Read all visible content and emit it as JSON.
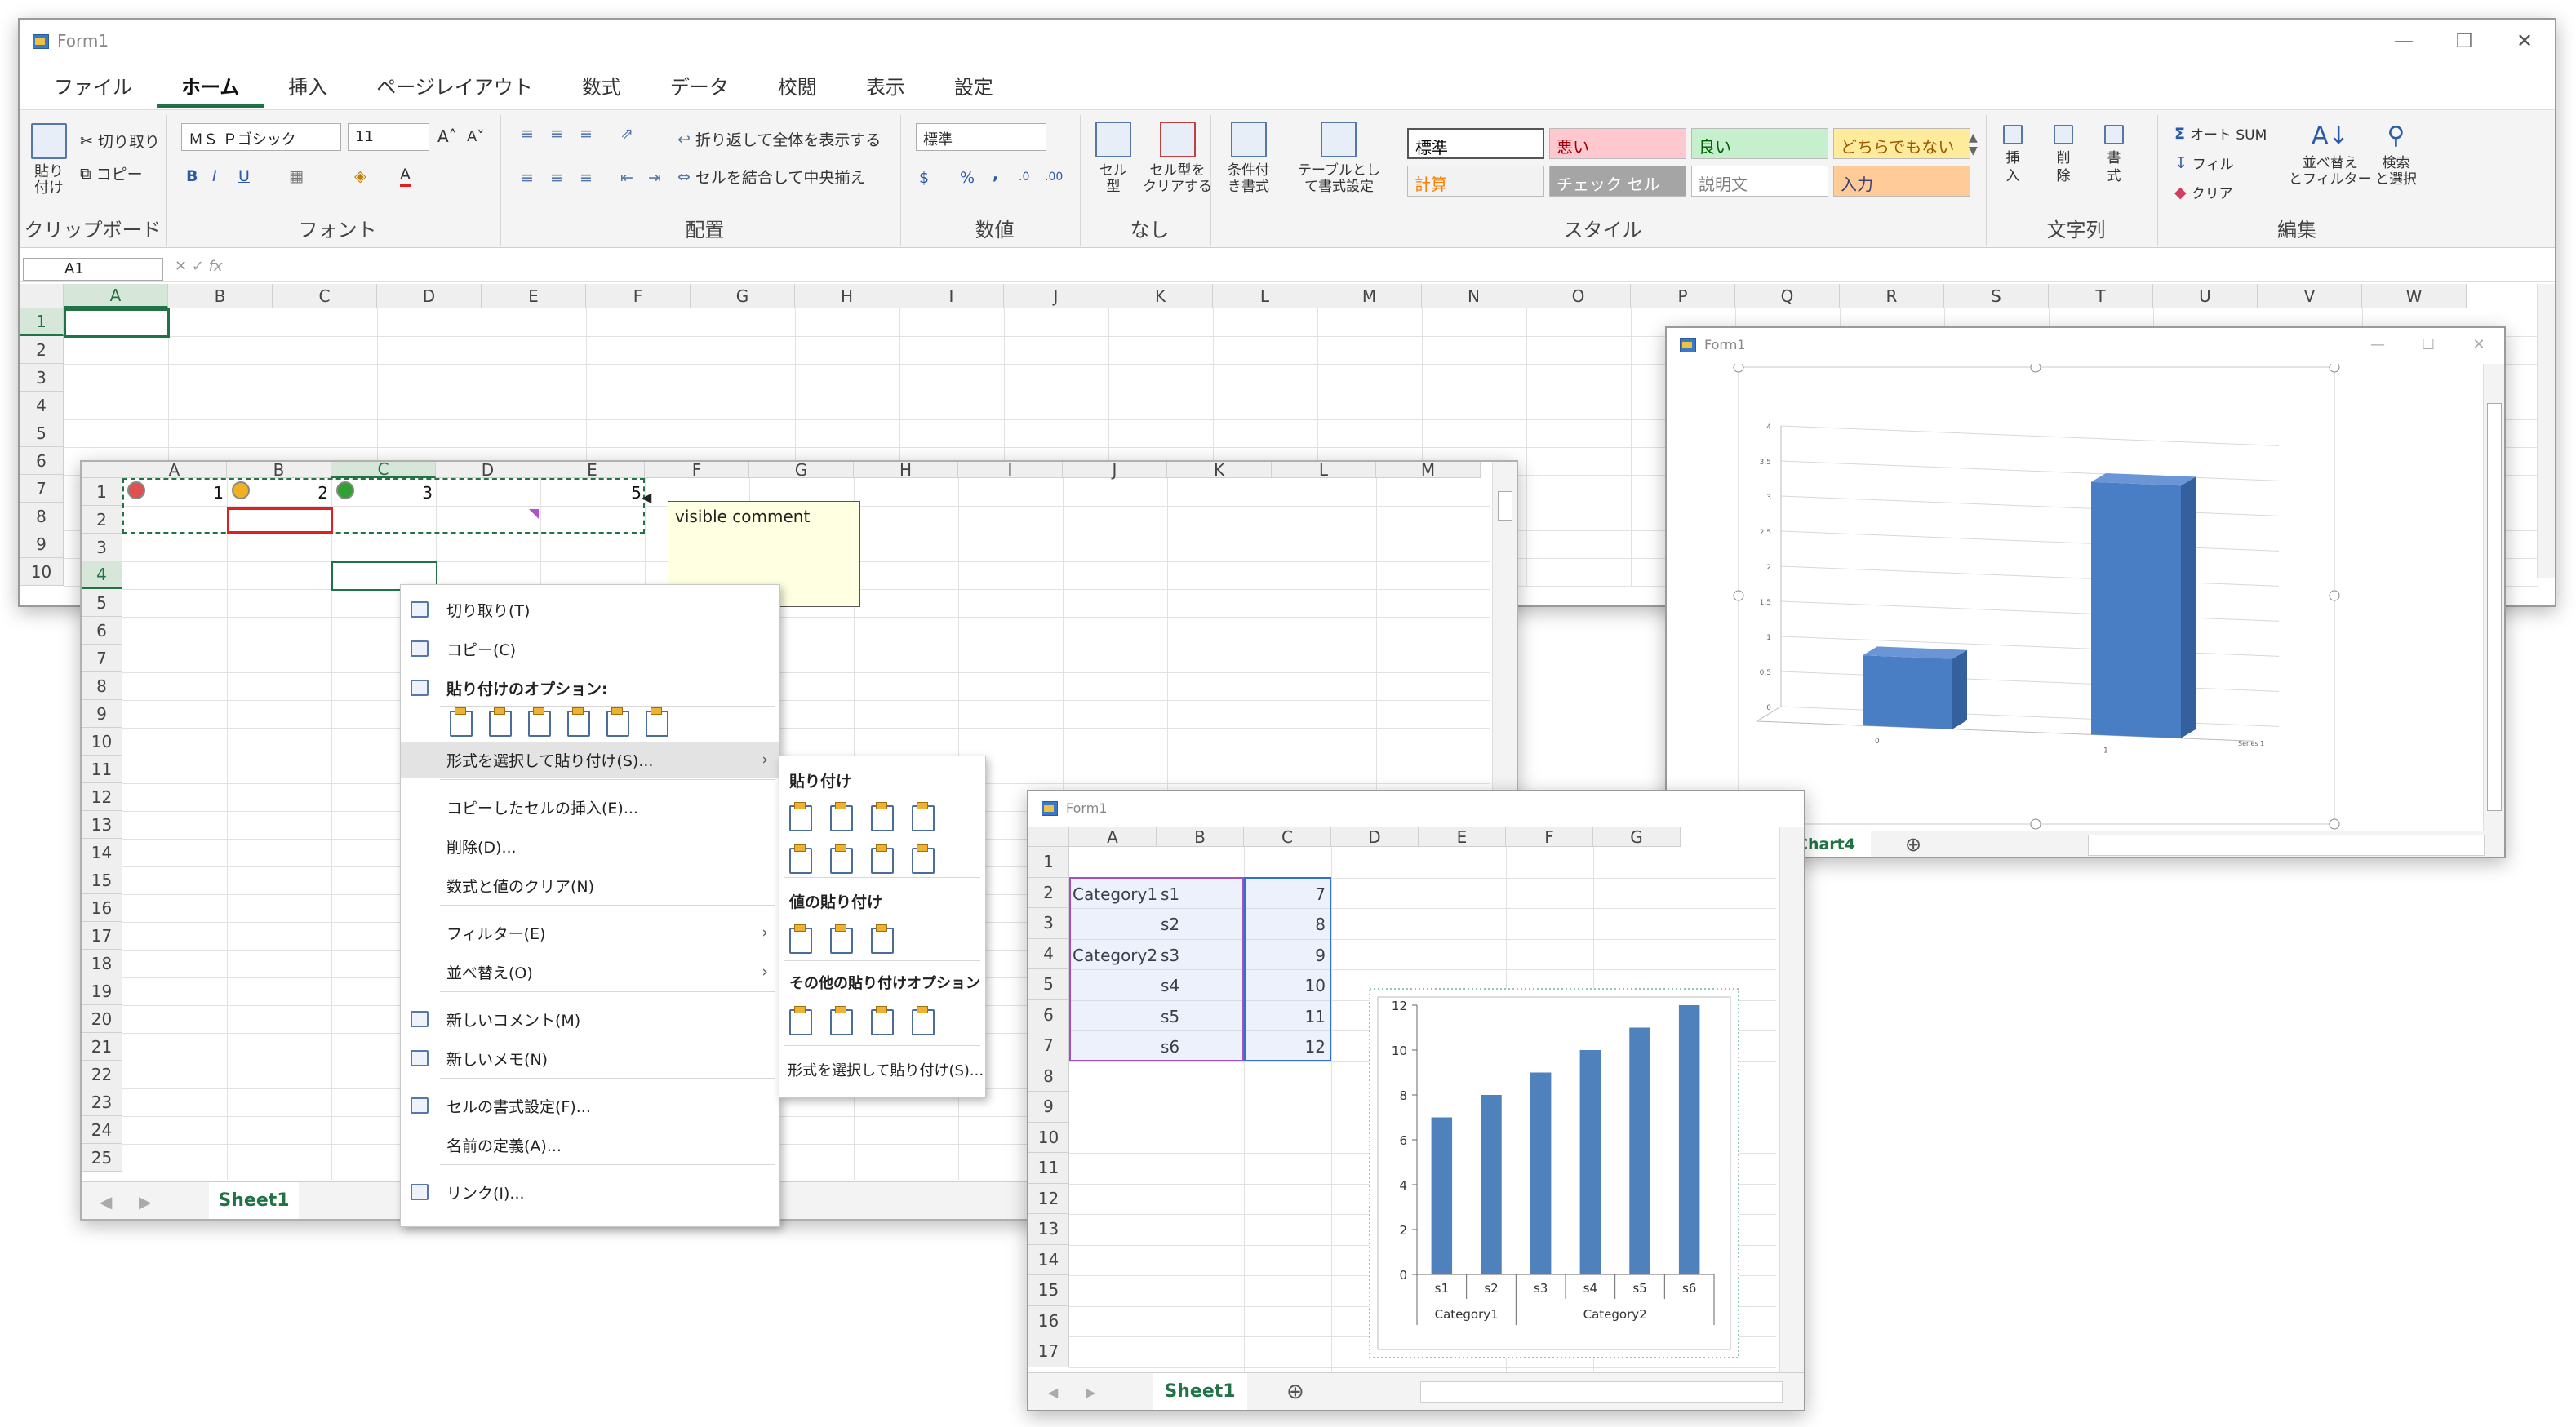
{
  "main_window": {
    "title": "Form1",
    "tabs": [
      "ファイル",
      "ホーム",
      "挿入",
      "ページレイアウト",
      "数式",
      "データ",
      "校閲",
      "表示",
      "設定"
    ],
    "active_tab": "ホーム",
    "clipboard": {
      "paste": "貼り\n付け",
      "cut": "切り取り",
      "copy": "コピー",
      "label": "クリップボード"
    },
    "font": {
      "name": "ＭＳ Ｐゴシック",
      "size": "11",
      "bold": "B",
      "italic": "I",
      "underline": "U",
      "label": "フォント"
    },
    "alignment": {
      "wrap": "折り返して全体を表示する",
      "merge": "セルを結合して中央揃え",
      "label": "配置"
    },
    "number": {
      "format": "標準",
      "currency": "$",
      "percent": "%",
      "comma": ",",
      "label": "数値"
    },
    "cells_group": {
      "cell_type": "セル\n型",
      "clear_cell_type": "セル型を\nクリアする",
      "label": "なし"
    },
    "styles": {
      "cond_format": "条件付\nき書式",
      "table_format": "テーブルとし\nて書式設定",
      "items": [
        {
          "text": "標準",
          "bg": "#ffffff",
          "fg": "#000000"
        },
        {
          "text": "悪い",
          "bg": "#ffc7ce",
          "fg": "#9c0006"
        },
        {
          "text": "良い",
          "bg": "#c6efce",
          "fg": "#006100"
        },
        {
          "text": "どちらでもない",
          "bg": "#ffeb9c",
          "fg": "#9c5700"
        },
        {
          "text": "計算",
          "bg": "#f2f2f2",
          "fg": "#fa7d00"
        },
        {
          "text": "チェック セル",
          "bg": "#a5a5a5",
          "fg": "#ffffff"
        },
        {
          "text": "説明文",
          "bg": "#ffffff",
          "fg": "#7f7f7f"
        },
        {
          "text": "入力",
          "bg": "#ffcc99",
          "fg": "#3f3f76"
        }
      ],
      "label": "スタイル"
    },
    "columns_group": {
      "insert": "挿\n入",
      "delete": "削\n除",
      "format": "書\n式",
      "label": "文字列"
    },
    "editing": {
      "autosum": "オート SUM",
      "fill": "フィル",
      "clear": "クリア",
      "sort": "並べ替え\nとフィルター",
      "find": "検索\nと選択",
      "label": "編集"
    },
    "name_box": "A1",
    "fx": "fx",
    "columns": [
      "A",
      "B",
      "C",
      "D",
      "E",
      "F",
      "G",
      "H",
      "I",
      "J",
      "K",
      "L",
      "M",
      "N",
      "O",
      "P",
      "Q",
      "R",
      "S",
      "T",
      "U",
      "V",
      "W"
    ],
    "rows": [
      "1",
      "2",
      "3",
      "4",
      "5",
      "6",
      "7",
      "8",
      "9",
      "10"
    ]
  },
  "sheet_window": {
    "columns": [
      "A",
      "B",
      "C",
      "D",
      "E",
      "F",
      "G",
      "H",
      "I",
      "J",
      "K",
      "L",
      "M"
    ],
    "rows": [
      "1",
      "2",
      "3",
      "4",
      "5",
      "6",
      "7",
      "8",
      "9",
      "10",
      "11",
      "12",
      "13",
      "14",
      "15",
      "16",
      "17",
      "18",
      "19",
      "20",
      "21",
      "22",
      "23",
      "24",
      "25"
    ],
    "row1_values": [
      "1",
      "2",
      "3",
      "5"
    ],
    "comment": "visible comment",
    "sheet_tab": "Sheet1"
  },
  "context_menu": {
    "items": [
      {
        "label": "切り取り(T)",
        "icon": "scissors-icon"
      },
      {
        "label": "コピー(C)",
        "icon": "copy-icon"
      },
      {
        "label": "貼り付けのオプション:",
        "icon": "paste-icon"
      },
      {
        "label": "形式を選択して貼り付け(S)...",
        "icon": ""
      },
      {
        "label": "コピーしたセルの挿入(E)...",
        "icon": ""
      },
      {
        "label": "削除(D)...",
        "icon": ""
      },
      {
        "label": "数式と値のクリア(N)",
        "icon": ""
      },
      {
        "label": "フィルター(E)",
        "icon": ""
      },
      {
        "label": "並べ替え(O)",
        "icon": ""
      },
      {
        "label": "新しいコメント(M)",
        "icon": "comment-icon"
      },
      {
        "label": "新しいメモ(N)",
        "icon": "note-icon"
      },
      {
        "label": "セルの書式設定(F)...",
        "icon": "format-cells-icon"
      },
      {
        "label": "名前の定義(A)...",
        "icon": ""
      },
      {
        "label": "リンク(I)...",
        "icon": "link-icon"
      }
    ]
  },
  "paste_submenu": {
    "paste_header": "貼り付け",
    "values_header": "値の貼り付け",
    "other_header": "その他の貼り付けオプション",
    "special": "形式を選択して貼り付け(S)..."
  },
  "chart_window_3d": {
    "title": "Form1",
    "sheet_tab": "Chart4",
    "chart_data": {
      "type": "bar",
      "categories": [
        "0",
        "1"
      ],
      "values": [
        1.0,
        3.6
      ],
      "yticks": [
        "0",
        "0.5",
        "1",
        "1.5",
        "2",
        "2.5",
        "3",
        "3.5",
        "4"
      ],
      "series_label": "Series 1",
      "ylim": [
        0,
        4
      ],
      "grid": true,
      "legend": "none"
    }
  },
  "data_window": {
    "title": "Form1",
    "columns": [
      "A",
      "B",
      "C",
      "D",
      "E",
      "F",
      "G"
    ],
    "rows": [
      "1",
      "2",
      "3",
      "4",
      "5",
      "6",
      "7",
      "8",
      "9",
      "10",
      "11",
      "12",
      "13",
      "14",
      "15",
      "16",
      "17"
    ],
    "table": [
      {
        "row": "2",
        "a": "Category1",
        "b": "s1",
        "c": "7"
      },
      {
        "row": "3",
        "a": "",
        "b": "s2",
        "c": "8"
      },
      {
        "row": "4",
        "a": "Category2",
        "b": "s3",
        "c": "9"
      },
      {
        "row": "5",
        "a": "",
        "b": "s4",
        "c": "10"
      },
      {
        "row": "6",
        "a": "",
        "b": "s5",
        "c": "11"
      },
      {
        "row": "7",
        "a": "",
        "b": "s6",
        "c": "12"
      }
    ],
    "sheet_tab": "Sheet1",
    "chart_data": {
      "type": "bar",
      "categories": [
        "s1",
        "s2",
        "s3",
        "s4",
        "s5",
        "s6"
      ],
      "groups": [
        "Category1",
        "Category2"
      ],
      "values": [
        7,
        8,
        9,
        10,
        11,
        12
      ],
      "yticks": [
        "0",
        "2",
        "4",
        "6",
        "8",
        "10",
        "12"
      ],
      "ylim": [
        0,
        12
      ],
      "bar_color": "#4f81bd",
      "grid": false,
      "legend": "none"
    }
  },
  "colors": {
    "accent": "#217346",
    "selection": "#217346"
  }
}
